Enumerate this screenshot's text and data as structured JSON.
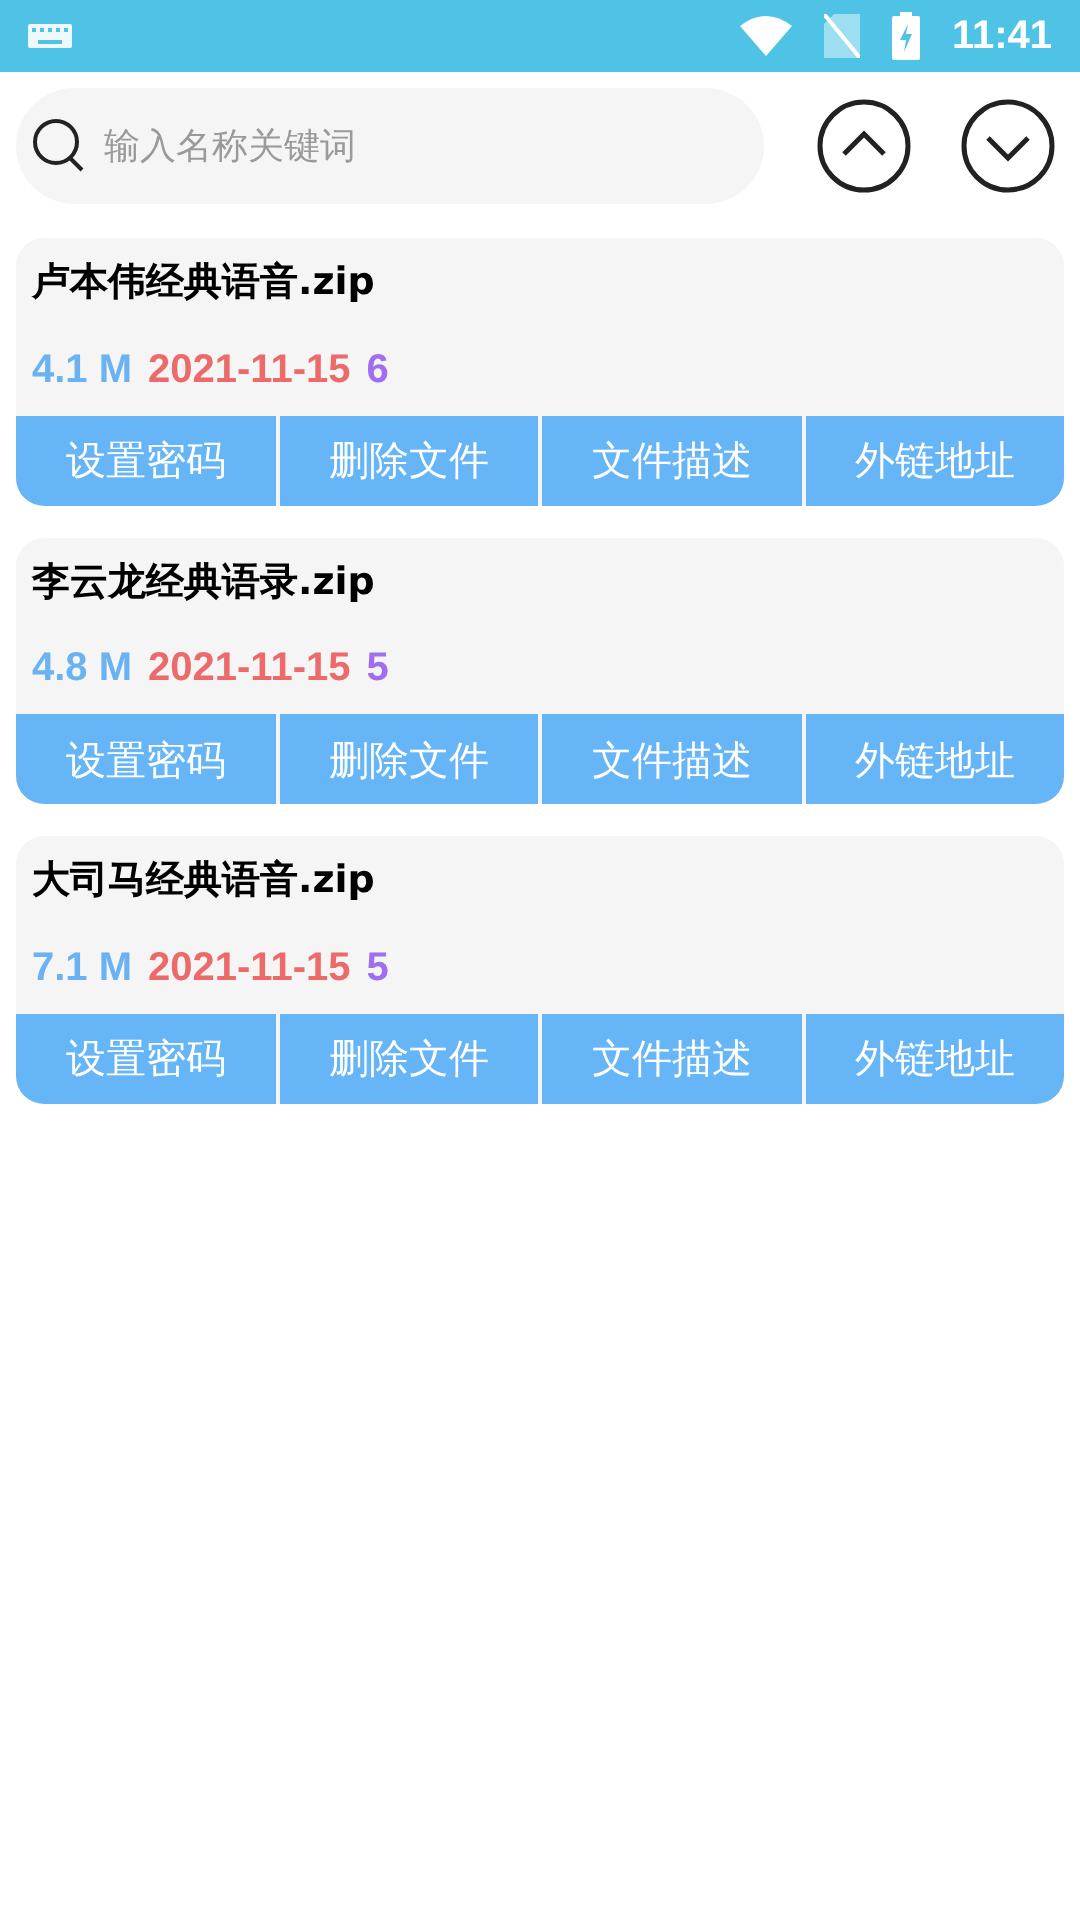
{
  "status_bar": {
    "time": "11:41"
  },
  "search": {
    "placeholder": "输入名称关键词"
  },
  "files": [
    {
      "name": "卢本伟经典语音.zip",
      "size": "4.1 M",
      "date": "2021-11-15",
      "count": "6",
      "actions": [
        "设置密码",
        "删除文件",
        "文件描述",
        "外链地址"
      ]
    },
    {
      "name": "李云龙经典语录.zip",
      "size": "4.8 M",
      "date": "2021-11-15",
      "count": "5",
      "actions": [
        "设置密码",
        "删除文件",
        "文件描述",
        "外链地址"
      ]
    },
    {
      "name": "大司马经典语音.zip",
      "size": "7.1 M",
      "date": "2021-11-15",
      "count": "5",
      "actions": [
        "设置密码",
        "删除文件",
        "文件描述",
        "外链地址"
      ]
    }
  ]
}
